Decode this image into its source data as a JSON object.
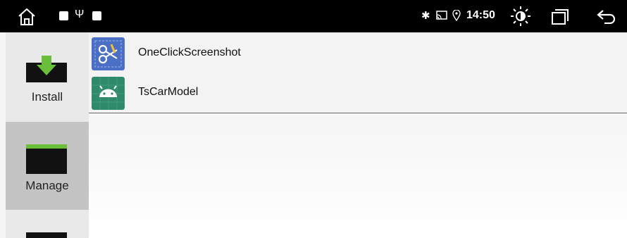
{
  "status_bar": {
    "time": "14:50",
    "usb_glyph": "Ψ",
    "bluetooth_glyph": "✱",
    "icons": [
      "home-icon",
      "notification-square-icon",
      "usb-icon",
      "notification-square-icon",
      "bluetooth-icon",
      "cast-icon",
      "location-icon",
      "brightness-icon",
      "recent-apps-icon",
      "back-icon"
    ]
  },
  "sidebar": {
    "items": [
      {
        "label": "Install",
        "icon": "download-folder-icon"
      },
      {
        "label": "Manage",
        "icon": "folder-icon",
        "active": true
      },
      {
        "label": "",
        "icon": "folder-icon"
      }
    ]
  },
  "apps": [
    {
      "name": "OneClickScreenshot",
      "icon": "scissors-screenshot-icon",
      "icon_color": "#4a6fc4"
    },
    {
      "name": "TsCarModel",
      "icon": "android-icon",
      "icon_color": "#2f8a6c"
    }
  ],
  "colors": {
    "status_bar_bg": "#000000",
    "sidebar_active": "#c4c4c4",
    "sidebar_bg": "#e9e9e9",
    "folder_tab": "#6abf3a",
    "arrow_green": "#6abf3a"
  }
}
